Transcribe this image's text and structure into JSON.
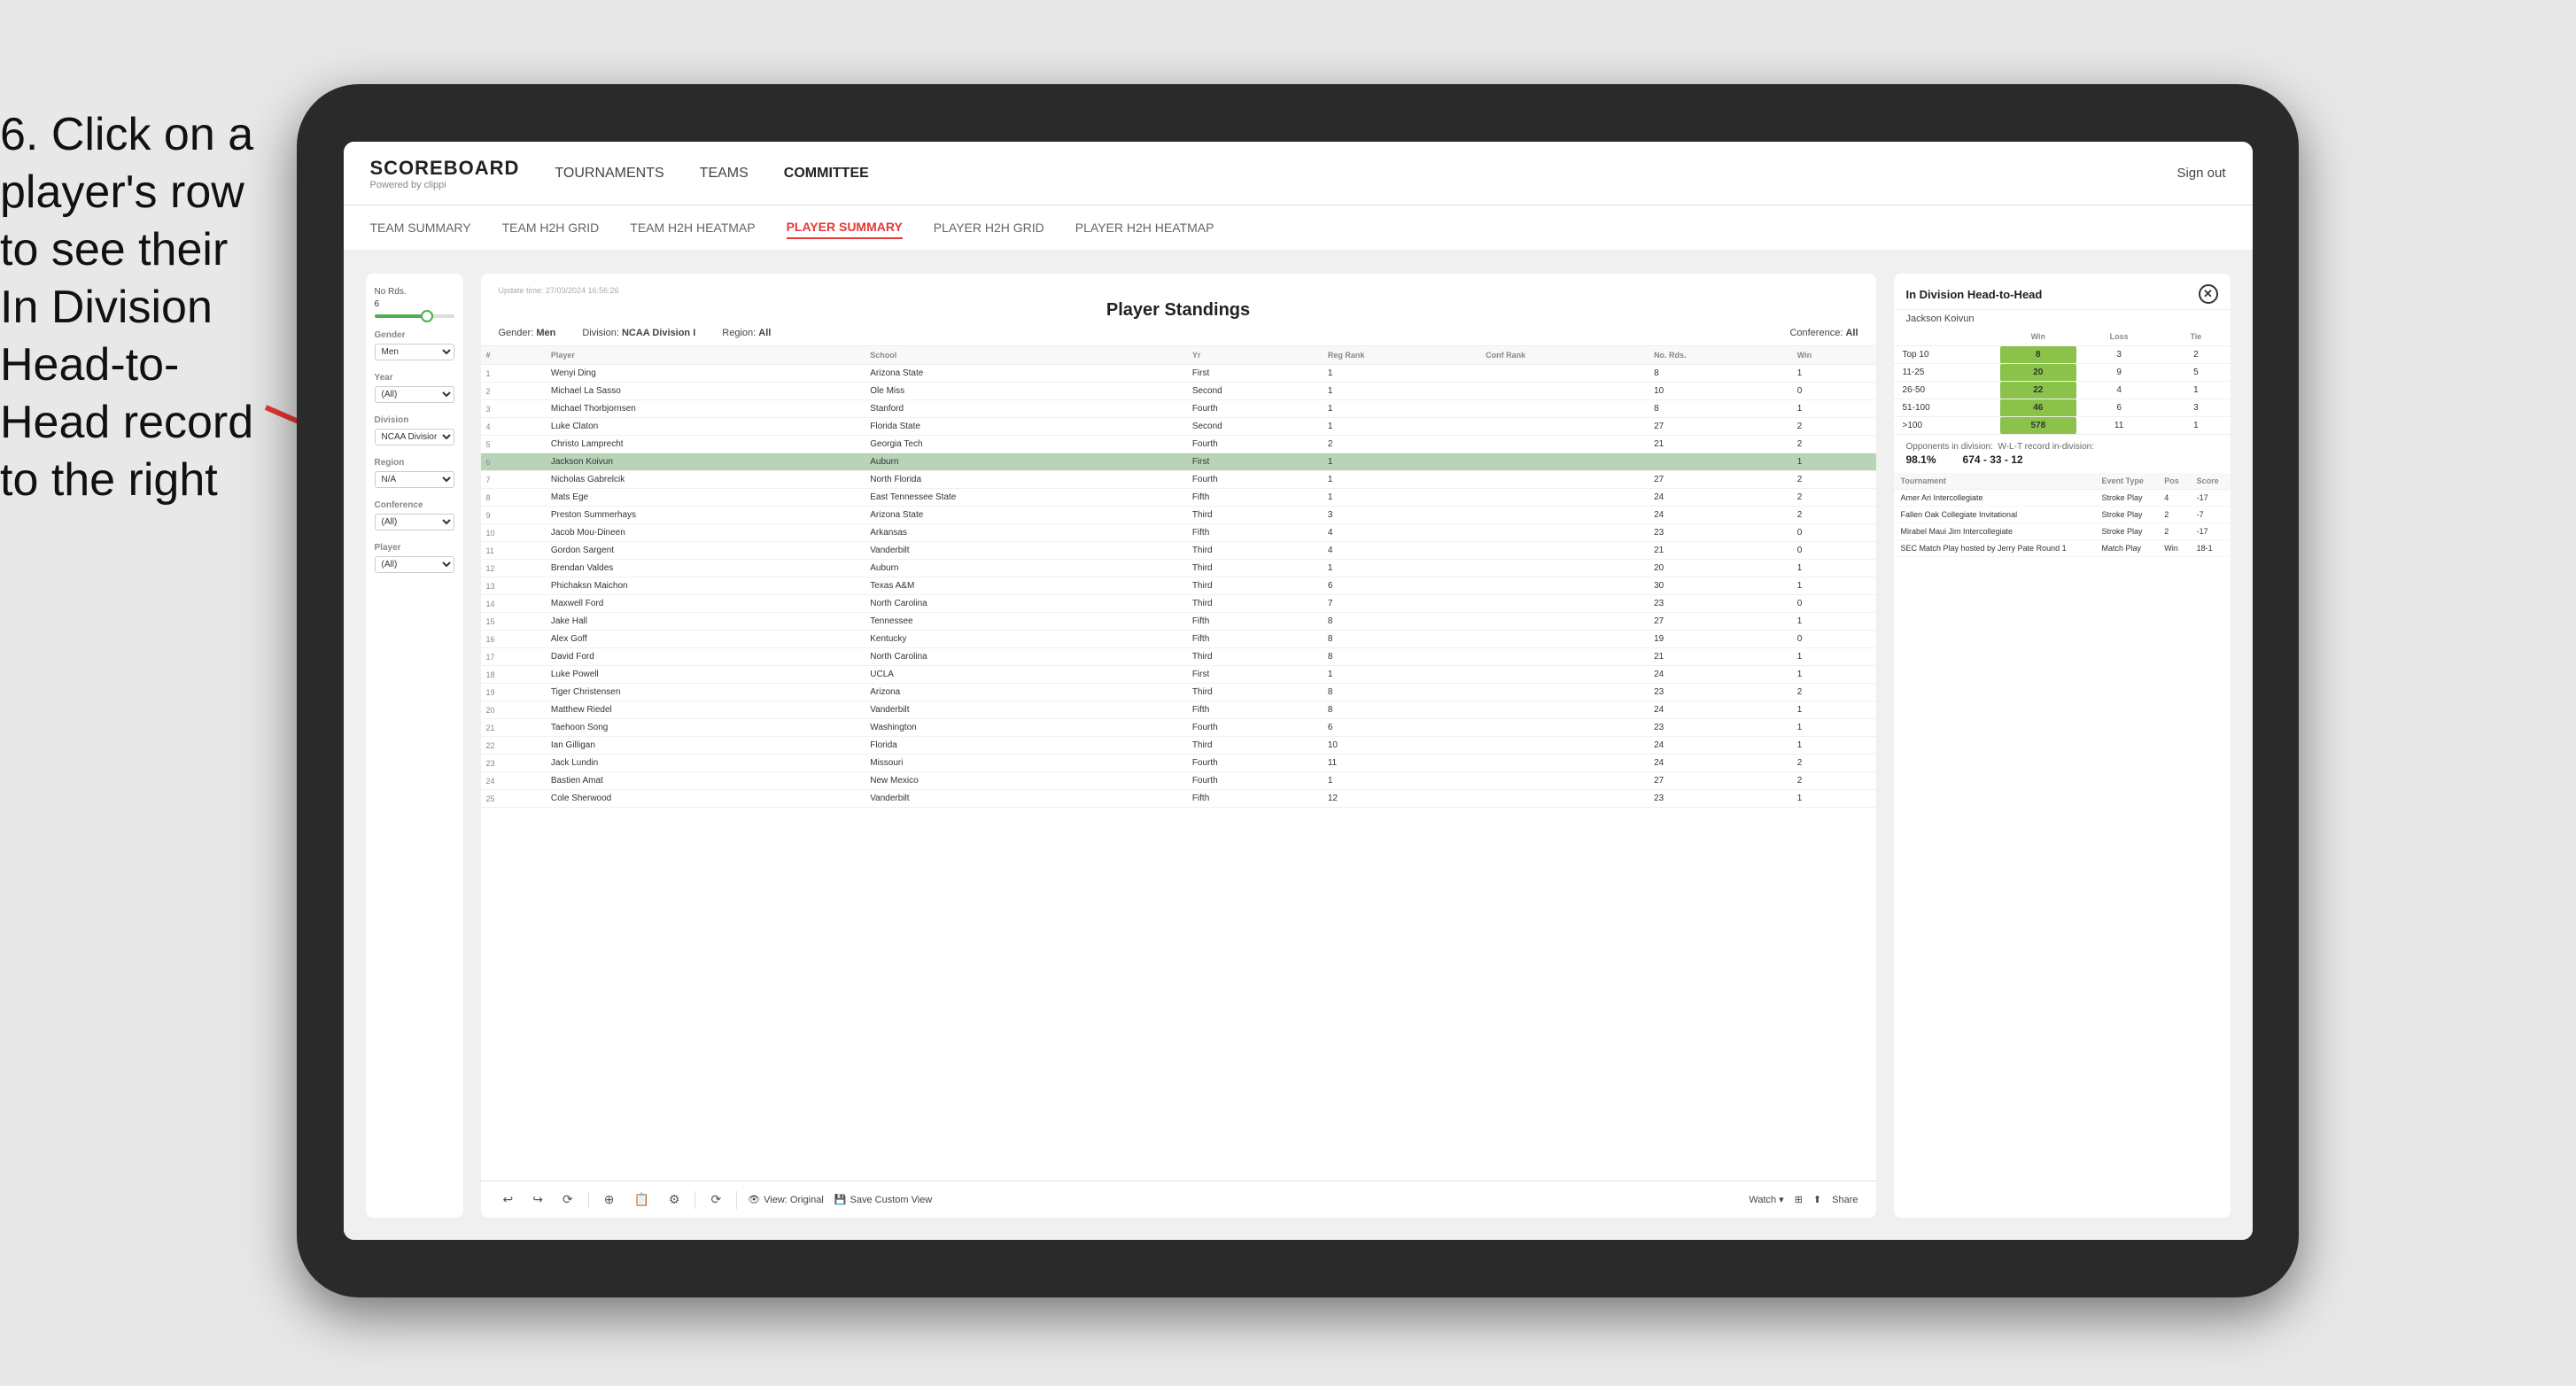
{
  "instruction": {
    "text": "6. Click on a player's row to see their In Division Head-to-Head record to the right"
  },
  "app": {
    "logo": "SCOREBOARD",
    "logo_sub": "Powered by clippi",
    "sign_out": "Sign out",
    "nav": [
      {
        "label": "TOURNAMENTS",
        "active": false
      },
      {
        "label": "TEAMS",
        "active": false
      },
      {
        "label": "COMMITTEE",
        "active": false
      }
    ],
    "sub_nav": [
      {
        "label": "TEAM SUMMARY",
        "active": false
      },
      {
        "label": "TEAM H2H GRID",
        "active": false
      },
      {
        "label": "TEAM H2H HEATMAP",
        "active": false
      },
      {
        "label": "PLAYER SUMMARY",
        "active": true
      },
      {
        "label": "PLAYER H2H GRID",
        "active": false
      },
      {
        "label": "PLAYER H2H HEATMAP",
        "active": false
      }
    ]
  },
  "filters": {
    "no_rds_label": "No Rds.",
    "no_rds_value": "6",
    "gender_label": "Gender",
    "gender_value": "Men",
    "year_label": "Year",
    "year_value": "(All)",
    "division_label": "Division",
    "division_value": "NCAA Division I",
    "region_label": "Region",
    "region_value": "N/A",
    "conference_label": "Conference",
    "conference_value": "(All)",
    "player_label": "Player",
    "player_value": "(All)"
  },
  "standings": {
    "update_time": "Update time: 27/03/2024 16:56:26",
    "title": "Player Standings",
    "gender": "Men",
    "division": "NCAA Division I",
    "region": "All",
    "conference": "All",
    "columns": [
      "#",
      "Player",
      "School",
      "Yr",
      "Reg Rank",
      "Conf Rank",
      "No. Rds.",
      "Win"
    ],
    "rows": [
      {
        "rank": 1,
        "num": 1,
        "player": "Wenyi Ding",
        "school": "Arizona State",
        "yr": "First",
        "reg_rank": 1,
        "conf_rank": "",
        "no_rds": 8,
        "win": 1
      },
      {
        "rank": 2,
        "num": 2,
        "player": "Michael La Sasso",
        "school": "Ole Miss",
        "yr": "Second",
        "reg_rank": 1,
        "conf_rank": "",
        "no_rds": 10,
        "win": 0
      },
      {
        "rank": 3,
        "num": 3,
        "player": "Michael Thorbjornsen",
        "school": "Stanford",
        "yr": "Fourth",
        "reg_rank": 1,
        "conf_rank": "",
        "no_rds": 8,
        "win": 1
      },
      {
        "rank": 4,
        "num": 4,
        "player": "Luke Claton",
        "school": "Florida State",
        "yr": "Second",
        "reg_rank": 1,
        "conf_rank": "",
        "no_rds": 27,
        "win": 2
      },
      {
        "rank": 5,
        "num": 5,
        "player": "Christo Lamprecht",
        "school": "Georgia Tech",
        "yr": "Fourth",
        "reg_rank": 2,
        "conf_rank": "",
        "no_rds": 21,
        "win": 2
      },
      {
        "rank": 6,
        "num": 6,
        "player": "Jackson Koivun",
        "school": "Auburn",
        "yr": "First",
        "reg_rank": 1,
        "conf_rank": "",
        "no_rds": "",
        "win": 1,
        "selected": true
      },
      {
        "rank": 7,
        "num": 7,
        "player": "Nicholas Gabrelcik",
        "school": "North Florida",
        "yr": "Fourth",
        "reg_rank": 1,
        "conf_rank": "",
        "no_rds": 27,
        "win": 2
      },
      {
        "rank": 8,
        "num": 8,
        "player": "Mats Ege",
        "school": "East Tennessee State",
        "yr": "Fifth",
        "reg_rank": 1,
        "conf_rank": "",
        "no_rds": 24,
        "win": 2
      },
      {
        "rank": 9,
        "num": 9,
        "player": "Preston Summerhays",
        "school": "Arizona State",
        "yr": "Third",
        "reg_rank": 3,
        "conf_rank": "",
        "no_rds": 24,
        "win": 2
      },
      {
        "rank": 10,
        "num": 10,
        "player": "Jacob Mou-Dineen",
        "school": "Arkansas",
        "yr": "Fifth",
        "reg_rank": 4,
        "conf_rank": "",
        "no_rds": 23,
        "win": 0
      },
      {
        "rank": 11,
        "num": 11,
        "player": "Gordon Sargent",
        "school": "Vanderbilt",
        "yr": "Third",
        "reg_rank": 4,
        "conf_rank": "",
        "no_rds": 21,
        "win": 0
      },
      {
        "rank": 12,
        "num": 12,
        "player": "Brendan Valdes",
        "school": "Auburn",
        "yr": "Third",
        "reg_rank": 1,
        "conf_rank": "",
        "no_rds": 20,
        "win": 1
      },
      {
        "rank": 13,
        "num": 13,
        "player": "Phichaksn Maichon",
        "school": "Texas A&M",
        "yr": "Third",
        "reg_rank": 6,
        "conf_rank": "",
        "no_rds": 30,
        "win": 1
      },
      {
        "rank": 14,
        "num": 14,
        "player": "Maxwell Ford",
        "school": "North Carolina",
        "yr": "Third",
        "reg_rank": 7,
        "conf_rank": "",
        "no_rds": 23,
        "win": 0
      },
      {
        "rank": 15,
        "num": 15,
        "player": "Jake Hall",
        "school": "Tennessee",
        "yr": "Fifth",
        "reg_rank": 8,
        "conf_rank": "",
        "no_rds": 27,
        "win": 1
      },
      {
        "rank": 16,
        "num": 16,
        "player": "Alex Goff",
        "school": "Kentucky",
        "yr": "Fifth",
        "reg_rank": 8,
        "conf_rank": "",
        "no_rds": 19,
        "win": 0
      },
      {
        "rank": 17,
        "num": 17,
        "player": "David Ford",
        "school": "North Carolina",
        "yr": "Third",
        "reg_rank": 8,
        "conf_rank": "",
        "no_rds": 21,
        "win": 1
      },
      {
        "rank": 18,
        "num": 18,
        "player": "Luke Powell",
        "school": "UCLA",
        "yr": "First",
        "reg_rank": 1,
        "conf_rank": "",
        "no_rds": 24,
        "win": 1
      },
      {
        "rank": 19,
        "num": 19,
        "player": "Tiger Christensen",
        "school": "Arizona",
        "yr": "Third",
        "reg_rank": 8,
        "conf_rank": "",
        "no_rds": 23,
        "win": 2
      },
      {
        "rank": 20,
        "num": 20,
        "player": "Matthew Riedel",
        "school": "Vanderbilt",
        "yr": "Fifth",
        "reg_rank": 8,
        "conf_rank": "",
        "no_rds": 24,
        "win": 1
      },
      {
        "rank": 21,
        "num": 21,
        "player": "Taehoon Song",
        "school": "Washington",
        "yr": "Fourth",
        "reg_rank": 6,
        "conf_rank": "",
        "no_rds": 23,
        "win": 1
      },
      {
        "rank": 22,
        "num": 22,
        "player": "Ian Gilligan",
        "school": "Florida",
        "yr": "Third",
        "reg_rank": 10,
        "conf_rank": "",
        "no_rds": 24,
        "win": 1
      },
      {
        "rank": 23,
        "num": 23,
        "player": "Jack Lundin",
        "school": "Missouri",
        "yr": "Fourth",
        "reg_rank": 11,
        "conf_rank": "",
        "no_rds": 24,
        "win": 2
      },
      {
        "rank": 24,
        "num": 24,
        "player": "Bastien Amat",
        "school": "New Mexico",
        "yr": "Fourth",
        "reg_rank": 1,
        "conf_rank": "",
        "no_rds": 27,
        "win": 2
      },
      {
        "rank": 25,
        "num": 25,
        "player": "Cole Sherwood",
        "school": "Vanderbilt",
        "yr": "Fifth",
        "reg_rank": 12,
        "conf_rank": "",
        "no_rds": 23,
        "win": 1
      }
    ]
  },
  "h2h": {
    "title": "In Division Head-to-Head",
    "player": "Jackson Koivun",
    "columns": [
      "",
      "Win",
      "Loss",
      "Tie"
    ],
    "rows": [
      {
        "label": "Top 10",
        "win": 8,
        "loss": 3,
        "tie": 2
      },
      {
        "label": "11-25",
        "win": 20,
        "loss": 9,
        "tie": 5
      },
      {
        "label": "26-50",
        "win": 22,
        "loss": 4,
        "tie": 1
      },
      {
        "label": "51-100",
        "win": 46,
        "loss": 6,
        "tie": 3
      },
      {
        "label": ">100",
        "win": 578,
        "loss": 11,
        "tie": 1
      }
    ],
    "opponents_label": "Opponents in division:",
    "wlt_label": "W-L-T record in-division:",
    "opponents_pct": "98.1%",
    "record": "674 - 33 - 12",
    "tournaments_columns": [
      "Tournament",
      "Event Type",
      "Pos",
      "Score"
    ],
    "tournaments": [
      {
        "name": "Amer Ari Intercollegiate",
        "type": "Stroke Play",
        "pos": 4,
        "score": "-17"
      },
      {
        "name": "Fallen Oak Collegiate Invitational",
        "type": "Stroke Play",
        "pos": 2,
        "score": "-7"
      },
      {
        "name": "Mirabel Maui Jim Intercollegiate",
        "type": "Stroke Play",
        "pos": 2,
        "score": "-17"
      },
      {
        "name": "SEC Match Play hosted by Jerry Pate Round 1",
        "type": "Match Play",
        "pos": "Win",
        "score": "18-1"
      }
    ]
  },
  "toolbar": {
    "view_original": "View: Original",
    "save_custom": "Save Custom View",
    "watch": "Watch ▾",
    "share": "Share"
  }
}
